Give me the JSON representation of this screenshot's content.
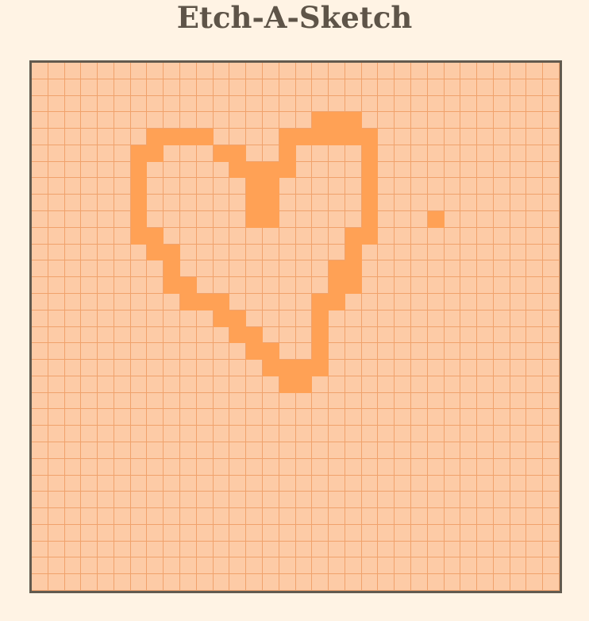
{
  "title": "Etch-A-Sketch",
  "board": {
    "grid_size": 32,
    "colors": {
      "background": "#fff3e4",
      "cell": "#fdcba6",
      "grid_line": "#f0a26c",
      "ink": "#ffa155",
      "frame": "#625a4e",
      "title": "#5e5448"
    },
    "filled_cells": [
      [
        3,
        17
      ],
      [
        3,
        18
      ],
      [
        3,
        19
      ],
      [
        4,
        7
      ],
      [
        4,
        8
      ],
      [
        4,
        9
      ],
      [
        4,
        10
      ],
      [
        4,
        15
      ],
      [
        4,
        16
      ],
      [
        4,
        17
      ],
      [
        4,
        18
      ],
      [
        4,
        19
      ],
      [
        4,
        20
      ],
      [
        5,
        6
      ],
      [
        5,
        7
      ],
      [
        5,
        11
      ],
      [
        5,
        12
      ],
      [
        5,
        15
      ],
      [
        5,
        20
      ],
      [
        6,
        6
      ],
      [
        6,
        12
      ],
      [
        6,
        13
      ],
      [
        6,
        14
      ],
      [
        6,
        15
      ],
      [
        6,
        20
      ],
      [
        7,
        6
      ],
      [
        7,
        13
      ],
      [
        7,
        14
      ],
      [
        7,
        20
      ],
      [
        8,
        6
      ],
      [
        8,
        13
      ],
      [
        8,
        14
      ],
      [
        8,
        20
      ],
      [
        9,
        6
      ],
      [
        9,
        13
      ],
      [
        9,
        14
      ],
      [
        9,
        20
      ],
      [
        9,
        24
      ],
      [
        10,
        6
      ],
      [
        10,
        7
      ],
      [
        10,
        19
      ],
      [
        10,
        20
      ],
      [
        11,
        7
      ],
      [
        11,
        8
      ],
      [
        11,
        19
      ],
      [
        12,
        8
      ],
      [
        12,
        18
      ],
      [
        12,
        19
      ],
      [
        13,
        8
      ],
      [
        13,
        9
      ],
      [
        13,
        18
      ],
      [
        13,
        19
      ],
      [
        14,
        9
      ],
      [
        14,
        10
      ],
      [
        14,
        11
      ],
      [
        14,
        17
      ],
      [
        14,
        18
      ],
      [
        15,
        11
      ],
      [
        15,
        12
      ],
      [
        15,
        17
      ],
      [
        16,
        12
      ],
      [
        16,
        13
      ],
      [
        16,
        17
      ],
      [
        17,
        13
      ],
      [
        17,
        14
      ],
      [
        17,
        17
      ],
      [
        18,
        14
      ],
      [
        18,
        15
      ],
      [
        18,
        16
      ],
      [
        18,
        17
      ],
      [
        19,
        15
      ],
      [
        19,
        16
      ]
    ]
  }
}
